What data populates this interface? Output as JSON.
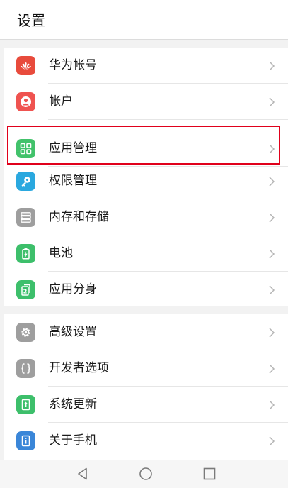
{
  "header": {
    "title": "设置"
  },
  "group1": [
    {
      "label": "华为帐号",
      "icon": "huawei-logo-icon",
      "color": "#e84b3c"
    },
    {
      "label": "帐户",
      "icon": "user-icon",
      "color": "#ef5350"
    },
    {
      "label": "应用管理",
      "icon": "apps-grid-icon",
      "color": "#42c26b"
    },
    {
      "label": "权限管理",
      "icon": "key-icon",
      "color": "#2aa8df"
    },
    {
      "label": "内存和存储",
      "icon": "storage-icon",
      "color": "#9e9e9e"
    },
    {
      "label": "电池",
      "icon": "battery-icon",
      "color": "#3dbf6b"
    },
    {
      "label": "应用分身",
      "icon": "app-twin-icon",
      "color": "#3dbf6b"
    }
  ],
  "group2": [
    {
      "label": "高级设置",
      "icon": "gear-icon",
      "color": "#9e9e9e"
    },
    {
      "label": "开发者选项",
      "icon": "braces-icon",
      "color": "#9e9e9e"
    },
    {
      "label": "系统更新",
      "icon": "system-update-icon",
      "color": "#3dbf6b"
    },
    {
      "label": "关于手机",
      "icon": "phone-info-icon",
      "color": "#3a86d8"
    }
  ],
  "highlighted_item": "应用管理",
  "navbar": {
    "back": "back-icon",
    "home": "home-icon",
    "recents": "recents-icon"
  }
}
